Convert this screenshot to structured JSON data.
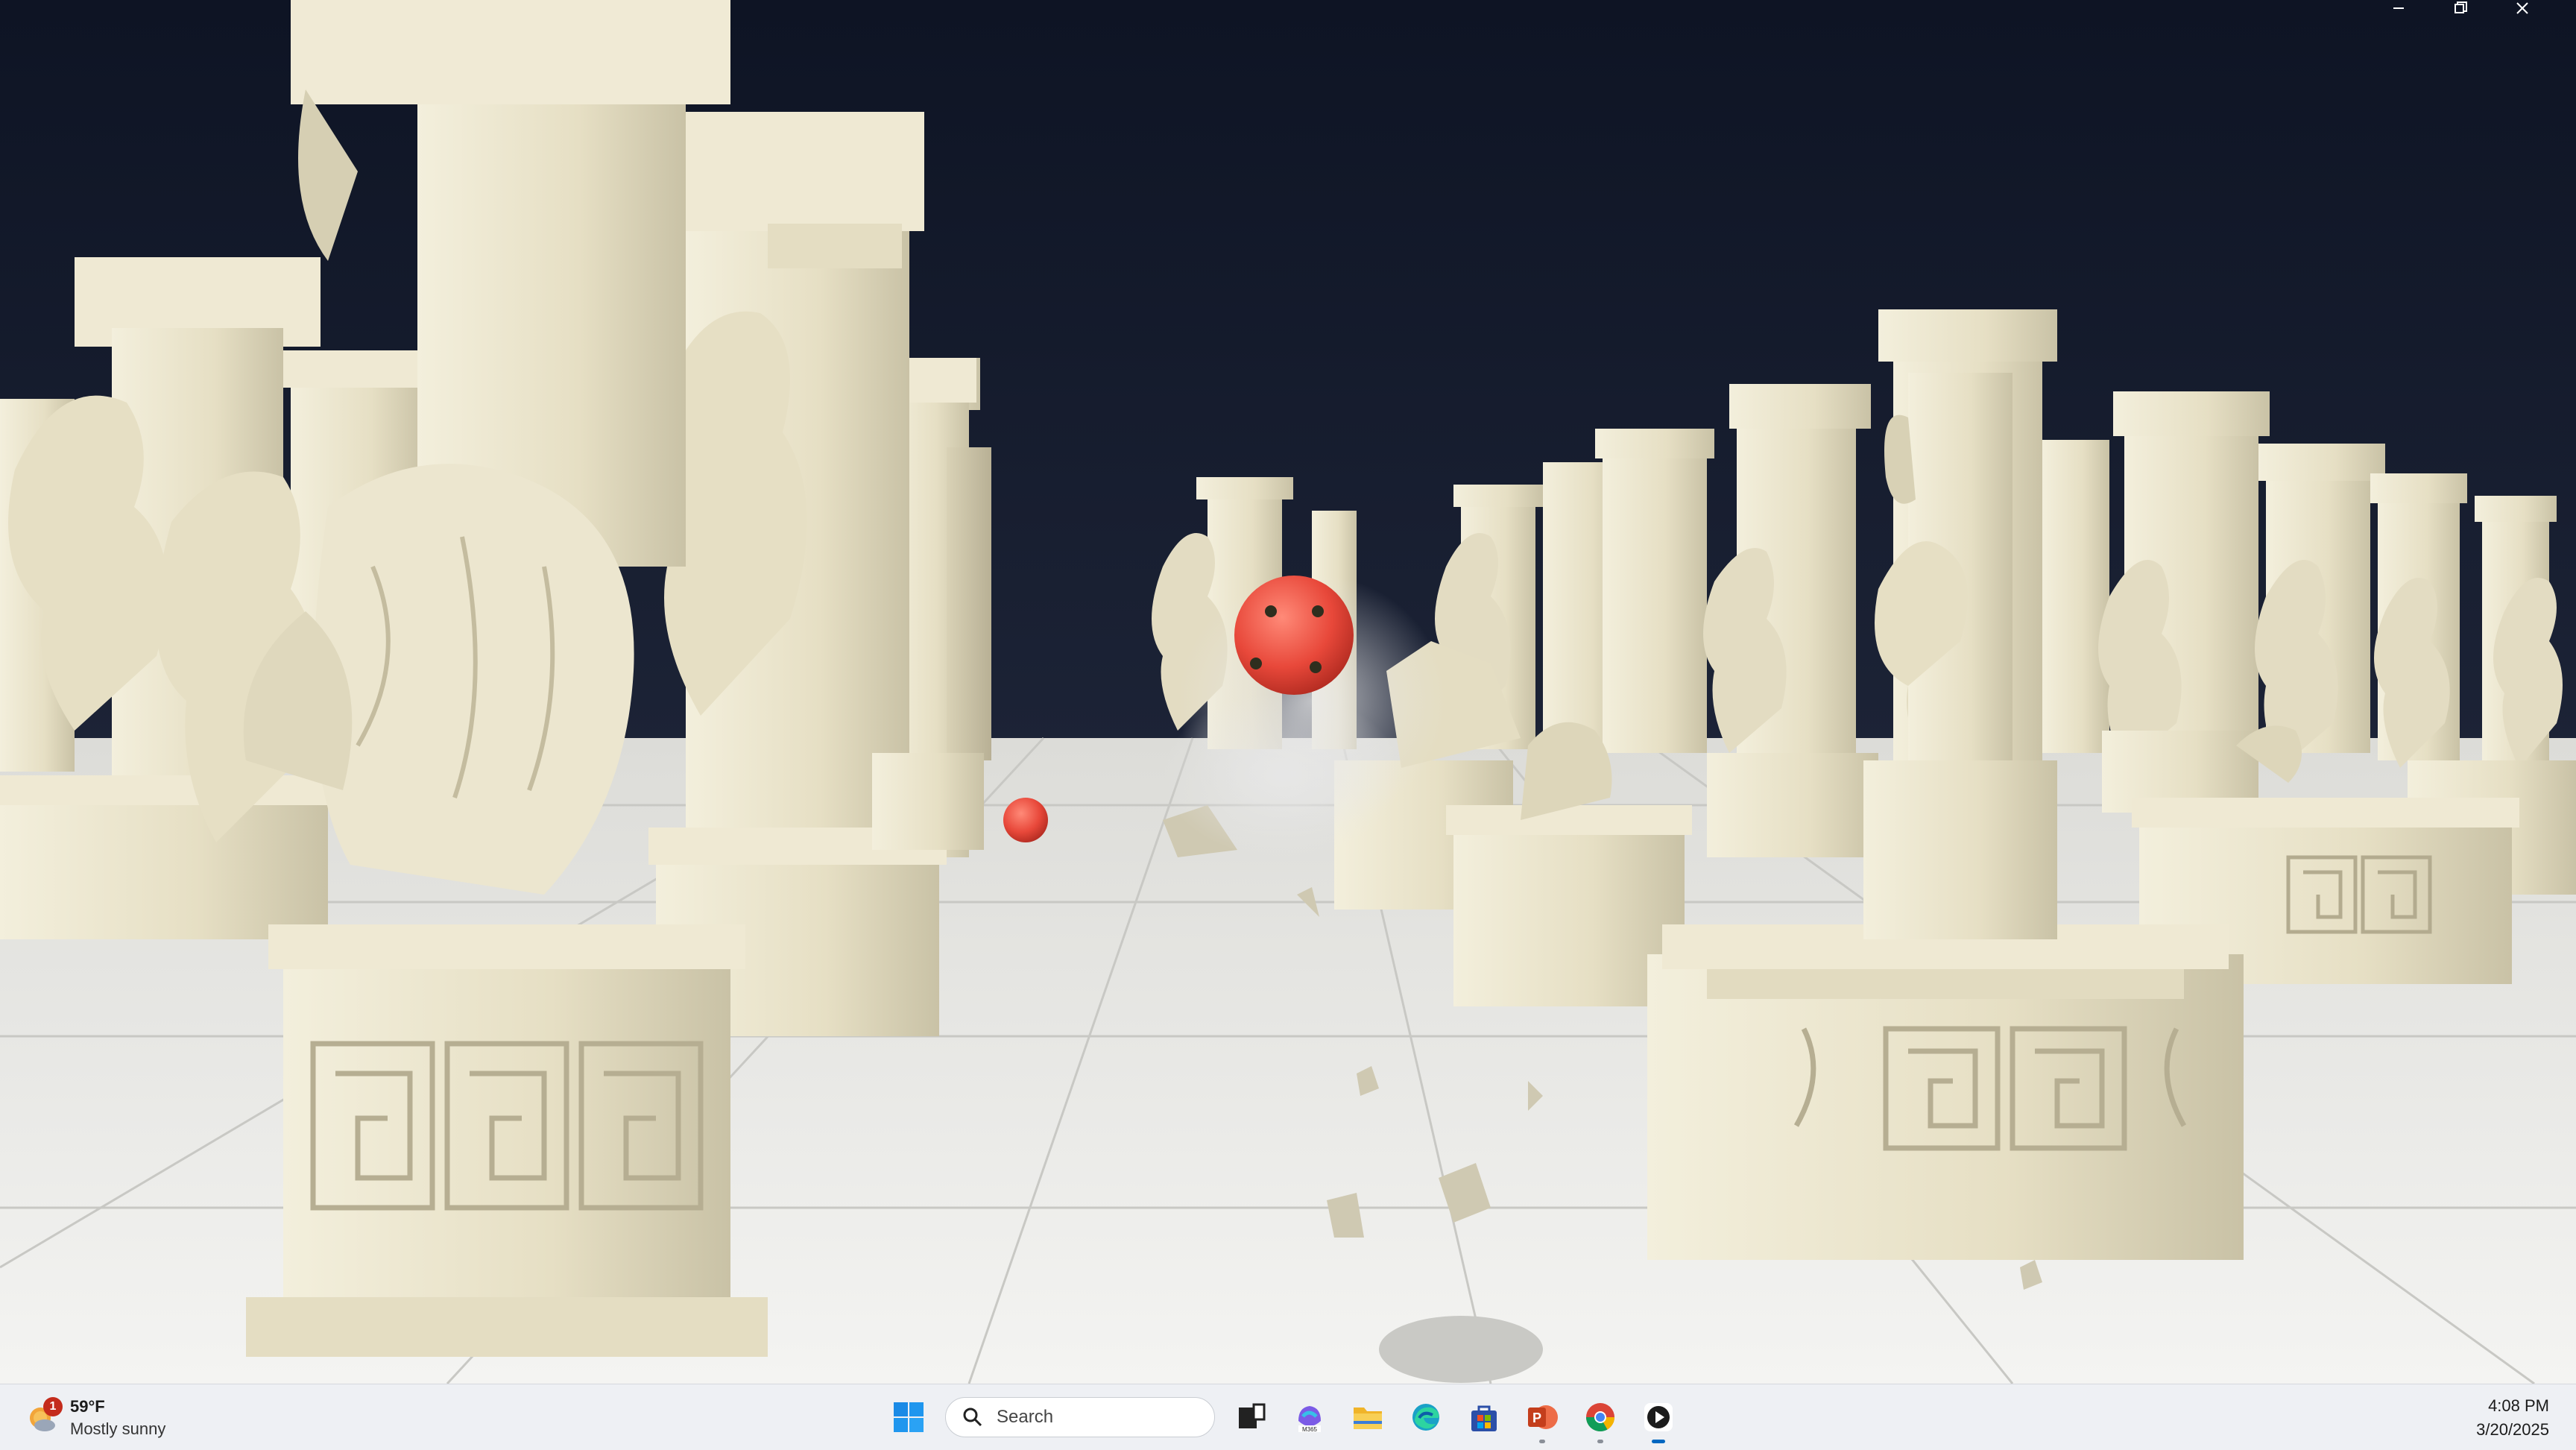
{
  "window": {
    "minimize_icon": "minimize-icon",
    "maximize_icon": "restore-icon",
    "close_icon": "close-icon"
  },
  "scene": {
    "description_icon": "game-scene",
    "sky_color": "#10172a",
    "floor_color": "#f1f1ee",
    "stone_color": "#e9e4cf",
    "ball_color": "#e8483a"
  },
  "taskbar": {
    "weather": {
      "temperature": "59°F",
      "condition": "Mostly sunny",
      "badge": "1",
      "icon": "sun-cloud-icon"
    },
    "search": {
      "placeholder": "Search",
      "icon": "search-icon"
    },
    "apps": [
      {
        "name": "start",
        "icon": "windows-start-icon"
      },
      {
        "name": "task-view",
        "icon": "task-view-icon"
      },
      {
        "name": "m365",
        "icon": "m365-copilot-icon",
        "label": "M365"
      },
      {
        "name": "file-explorer",
        "icon": "folder-icon"
      },
      {
        "name": "edge",
        "icon": "edge-icon"
      },
      {
        "name": "store",
        "icon": "store-icon"
      },
      {
        "name": "powerpoint",
        "icon": "powerpoint-icon"
      },
      {
        "name": "chrome",
        "icon": "chrome-icon"
      },
      {
        "name": "media-player",
        "icon": "media-player-icon"
      }
    ],
    "clock": {
      "time": "4:08 PM",
      "date": "3/20/2025"
    }
  }
}
